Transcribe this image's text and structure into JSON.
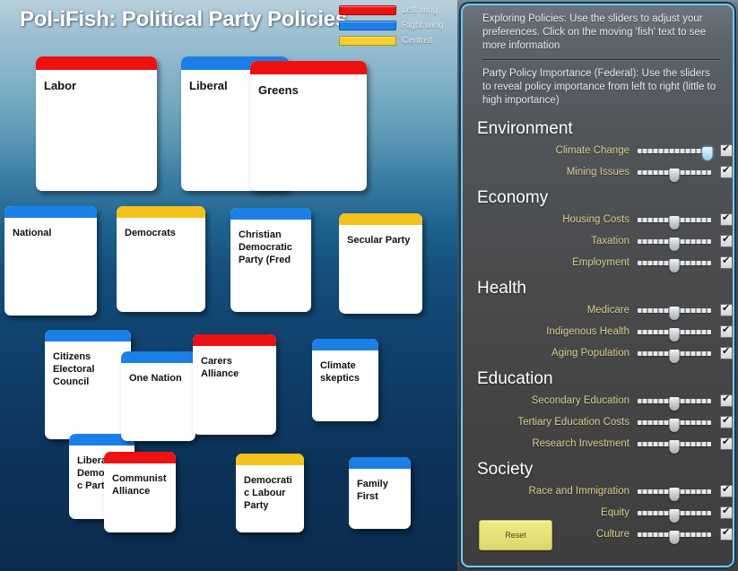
{
  "app": {
    "title": "Pol-iFish: Political Party Policies"
  },
  "legend": {
    "items": [
      {
        "label": "Left wing",
        "color": "#ee1111"
      },
      {
        "label": "Right wing",
        "color": "#1b7fe8"
      },
      {
        "label": "Centrist",
        "color": "#f5cf2b"
      }
    ]
  },
  "parties": [
    {
      "name": "Labor",
      "wing": "left",
      "color": "#ee1111"
    },
    {
      "name": "Liberal",
      "wing": "right",
      "color": "#1b7fe8"
    },
    {
      "name": "Greens",
      "wing": "left",
      "color": "#ee1111"
    },
    {
      "name": "National",
      "wing": "right",
      "color": "#1b7fe8"
    },
    {
      "name": "Democrats",
      "wing": "centrist",
      "color": "#f5c21b"
    },
    {
      "name": "Christian Democratic Party (Fred",
      "wing": "right",
      "color": "#1b7fe8"
    },
    {
      "name": "Secular Party",
      "wing": "centrist",
      "color": "#f5c21b"
    },
    {
      "name": "Citizens Electoral Council",
      "wing": "right",
      "color": "#1b7fe8"
    },
    {
      "name": "One Nation",
      "wing": "right",
      "color": "#1b7fe8"
    },
    {
      "name": "Carers Alliance",
      "wing": "left",
      "color": "#ee1111"
    },
    {
      "name": "Climate skeptics",
      "wing": "right",
      "color": "#1b7fe8"
    },
    {
      "name": "Liberal Democratic Party",
      "wing": "right",
      "color": "#1b7fe8"
    },
    {
      "name": "Communist Alliance",
      "wing": "left",
      "color": "#ee1111"
    },
    {
      "name": "Democratic Labour Party",
      "wing": "centrist",
      "color": "#f5c21b"
    },
    {
      "name": "Family First",
      "wing": "right",
      "color": "#1b7fe8"
    }
  ],
  "panel": {
    "info_1": "Exploring Policies: Use the sliders to adjust your preferences. Click on the moving 'fish' text to see more information",
    "info_2": "Party Policy Importance (Federal): Use the sliders to reveal policy importance from left to right (little to high importance)",
    "reset_label": "Reset",
    "sections": [
      {
        "title": "Environment",
        "rows": [
          {
            "label": "Climate Change",
            "value": 95,
            "checked": true,
            "highlight": true
          },
          {
            "label": "Mining Issues",
            "value": 50,
            "checked": true,
            "highlight": false
          }
        ]
      },
      {
        "title": "Economy",
        "rows": [
          {
            "label": "Housing Costs",
            "value": 50,
            "checked": true,
            "highlight": false
          },
          {
            "label": "Taxation",
            "value": 50,
            "checked": true,
            "highlight": false
          },
          {
            "label": "Employment",
            "value": 50,
            "checked": true,
            "highlight": false
          }
        ]
      },
      {
        "title": "Health",
        "rows": [
          {
            "label": "Medicare",
            "value": 50,
            "checked": true,
            "highlight": false
          },
          {
            "label": "Indigenous Health",
            "value": 50,
            "checked": true,
            "highlight": false
          },
          {
            "label": "Aging Population",
            "value": 50,
            "checked": true,
            "highlight": false
          }
        ]
      },
      {
        "title": "Education",
        "rows": [
          {
            "label": "Secondary Education",
            "value": 50,
            "checked": true,
            "highlight": false
          },
          {
            "label": "Tertiary Education Costs",
            "value": 50,
            "checked": true,
            "highlight": false
          },
          {
            "label": "Research Investment",
            "value": 50,
            "checked": true,
            "highlight": false
          }
        ]
      },
      {
        "title": "Society",
        "rows": [
          {
            "label": "Race and Immigration",
            "value": 50,
            "checked": true,
            "highlight": false
          },
          {
            "label": "Equity",
            "value": 50,
            "checked": true,
            "highlight": false
          },
          {
            "label": "Culture",
            "value": 50,
            "checked": true,
            "highlight": false
          }
        ]
      }
    ]
  }
}
